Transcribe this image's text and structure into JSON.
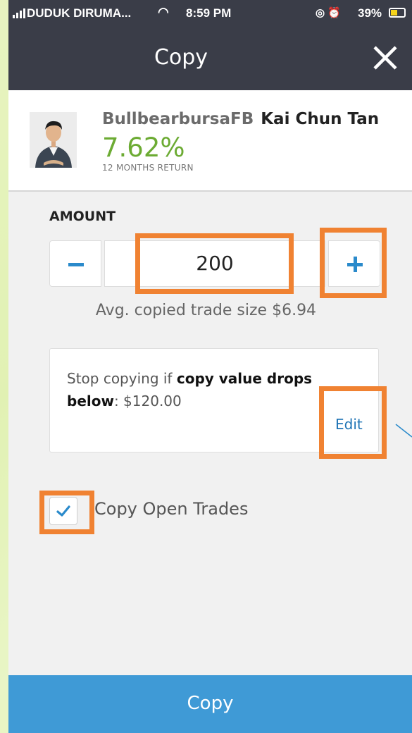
{
  "status_bar": {
    "carrier": "DUDUK DIRUMA...",
    "time": "8:59 PM",
    "battery": "39%"
  },
  "header": {
    "title": "Copy",
    "close_icon": "close-icon"
  },
  "trader": {
    "username": "BullbearbursaFB",
    "full_name": "Kai Chun Tan",
    "return_value": "7.62%",
    "return_label": "12 MONTHS RETURN"
  },
  "amount": {
    "label": "AMOUNT",
    "value": "200",
    "avg_trade_size": "Avg. copied trade size $6.94"
  },
  "stop_loss": {
    "prefix": "Stop copying if ",
    "bold": "copy value drops below",
    "suffix": ": $120.00",
    "edit_label": "Edit"
  },
  "copy_open_trades": {
    "label": "Copy Open Trades",
    "checked": true
  },
  "footer": {
    "copy_button": "Copy"
  },
  "colors": {
    "header_bg": "#3a3d48",
    "accent_blue": "#3f9ad6",
    "return_green": "#6cab33",
    "highlight_orange": "#f08232"
  }
}
